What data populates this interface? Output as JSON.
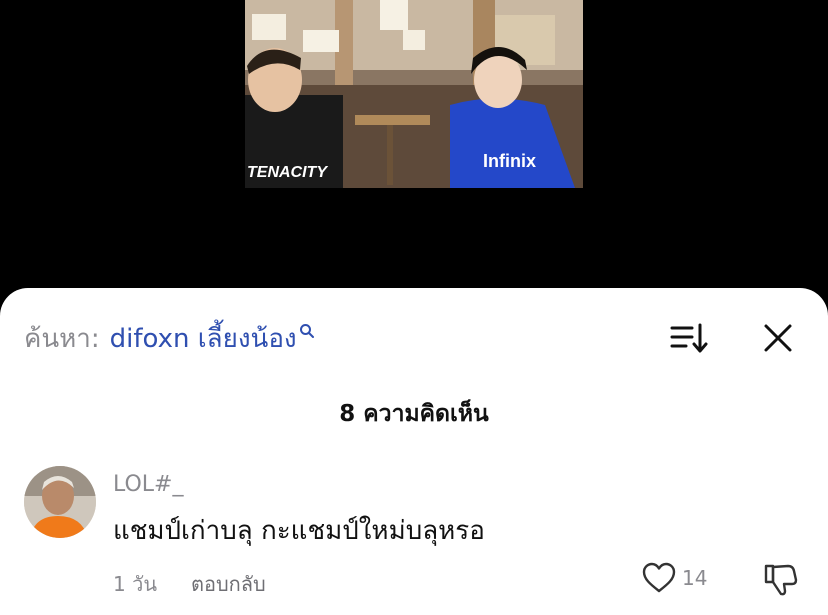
{
  "video": {
    "description_icon": "video-thumbnail"
  },
  "search": {
    "prefix": "ค้นหา:",
    "term": "difoxn เลี้ยงน้อง",
    "icon": "search-icon"
  },
  "header": {
    "sort_icon": "sort-icon",
    "close_icon": "close-icon",
    "comments_count": "8 ความคิดเห็น"
  },
  "comment": {
    "username": "LOL#_",
    "text": "แชมป์เก่าบลุ กะแชมป์ใหม่บลุหรอ",
    "time": "1 วัน",
    "reply_label": "ตอบกลับ",
    "like_count": "14",
    "like_icon": "heart-icon",
    "dislike_icon": "thumbs-down-icon"
  },
  "colors": {
    "accent": "#2f4fb0",
    "muted": "#8a8a8f",
    "background": "#000000",
    "sheet": "#ffffff"
  }
}
